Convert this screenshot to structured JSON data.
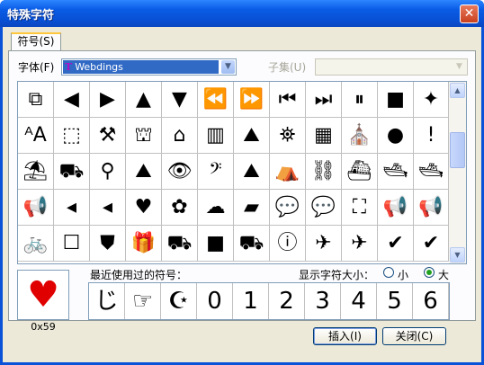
{
  "window": {
    "title": "特殊字符",
    "close_glyph": "✕"
  },
  "tab": {
    "label": "符号(S)"
  },
  "font": {
    "label": "字体(F)",
    "value": "Webdings",
    "icon": "T"
  },
  "subset": {
    "label": "子集(U)"
  },
  "grid_symbols": [
    [
      "⧉",
      "◀",
      "▶",
      "▲",
      "▼",
      "⏪",
      "⏩",
      "⏮",
      "⏭",
      "⏸"
    ],
    [
      "ᴬA",
      "⬚",
      "⚒",
      "⛫",
      "⌂",
      "▥",
      "⛰",
      "⛯",
      "▦",
      "⛪"
    ],
    [
      "⛱",
      "⛟",
      "⚲",
      "⛰",
      "👁",
      "𝄢",
      "⛰",
      "⛺",
      "⛓",
      "⛴"
    ],
    [
      "📢",
      "◂",
      "◂",
      "♥",
      "✿",
      "☁",
      "▰",
      "💬",
      "💬",
      "⛶"
    ],
    [
      "🚲",
      "☐",
      "⛊",
      "🎁",
      "⛟",
      "■",
      "⛟",
      "ⓘ",
      "✈",
      "✈"
    ]
  ],
  "extra_col": [
    "■",
    "●",
    "🛥",
    "📢",
    "✔",
    "✦",
    "!"
  ],
  "selected_preview": {
    "glyph": "♥",
    "code": "0x59"
  },
  "recent": {
    "label": "最近使用过的符号：",
    "symbols": [
      "じ",
      "☞",
      "☪",
      "0",
      "1",
      "2",
      "3",
      "4",
      "5",
      "6"
    ]
  },
  "size": {
    "label": "显示字符大小：",
    "small": "小",
    "large": "大",
    "selected": "large"
  },
  "buttons": {
    "insert": "插入(I)",
    "close": "关闭(C)"
  }
}
